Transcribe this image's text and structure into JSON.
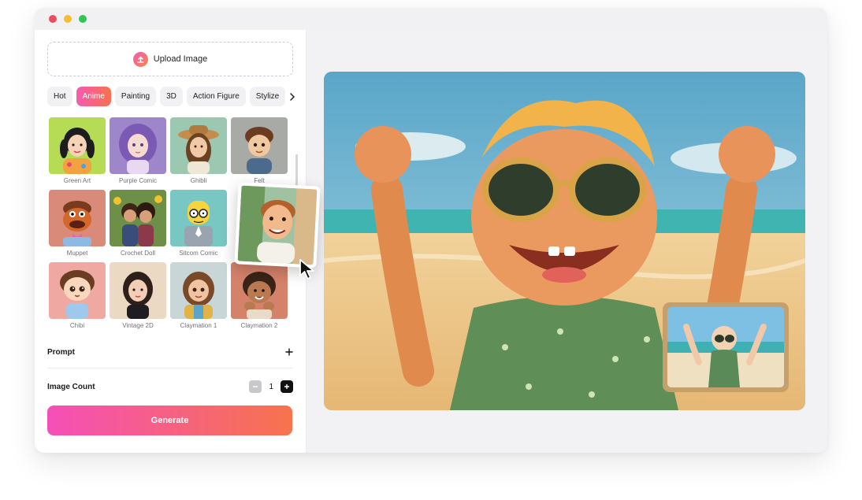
{
  "upload": {
    "label": "Upload Image"
  },
  "tabs": [
    {
      "label": "Hot"
    },
    {
      "label": "Anime"
    },
    {
      "label": "Painting"
    },
    {
      "label": "3D"
    },
    {
      "label": "Action Figure"
    },
    {
      "label": "Stylize"
    }
  ],
  "styles": [
    {
      "label": "Green Art"
    },
    {
      "label": "Purple Comic"
    },
    {
      "label": "Ghibli"
    },
    {
      "label": "Felt"
    },
    {
      "label": "Muppet"
    },
    {
      "label": "Crochet Doll"
    },
    {
      "label": "Sitcom Comic"
    },
    {
      "label": "Claymation 1"
    },
    {
      "label": "Chibi"
    },
    {
      "label": "Vintage 2D"
    },
    {
      "label": "Claymation 2"
    }
  ],
  "prompt": {
    "label": "Prompt"
  },
  "image_count": {
    "label": "Image Count",
    "value": "1"
  },
  "generate": {
    "label": "Generate"
  },
  "icons": [
    "upload-icon",
    "chevron-right-icon",
    "plus-icon",
    "minus-icon",
    "mouse-cursor-icon"
  ],
  "colors": {
    "accent_start": "#f75ab1",
    "accent_end": "#f7714e"
  }
}
